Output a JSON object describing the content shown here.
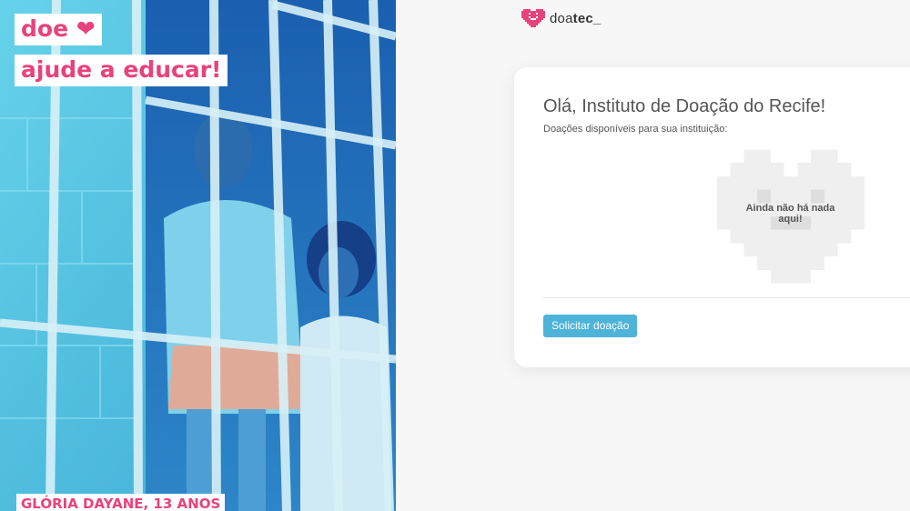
{
  "hero": {
    "slogan_line1": "doe",
    "slogan_heart": "❤",
    "slogan_line2": "ajude a educar!",
    "caption": "GLÓRIA DAYANE, 13 ANOS"
  },
  "brand": {
    "name_light": "doa",
    "name_bold": "tec_",
    "icon": "pixel-heart-smile-icon"
  },
  "card": {
    "title": "Olá, Instituto de Doação do Recife!",
    "subtitle": "Doações disponíveis para sua instituição:",
    "empty_message": "Ainda não há nada aqui!",
    "request_button": "Solicitar doação"
  },
  "colors": {
    "accent_pink": "#e8427c",
    "button_blue": "#4eb3d8",
    "photo_tint": "#1e6fb8"
  }
}
